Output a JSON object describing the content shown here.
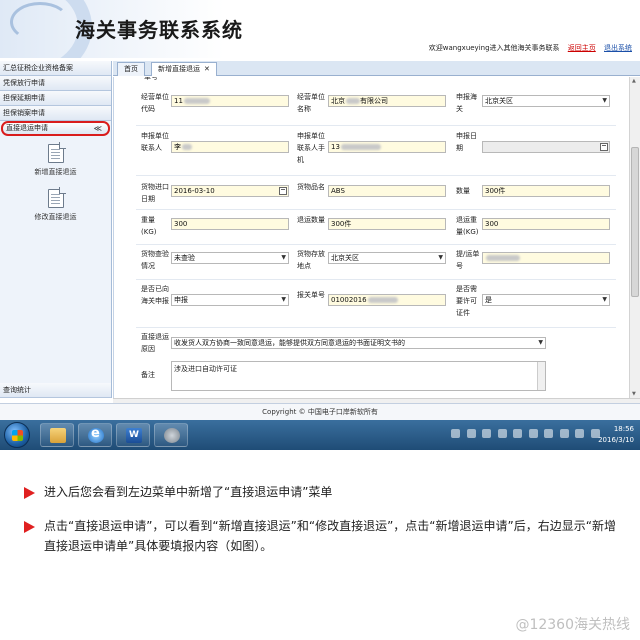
{
  "header": {
    "title": "海关事务联系系统",
    "welcome_text": "欢迎wangxueying进入其他海关事务联系",
    "return_home": "返回主页",
    "logout": "退出系统"
  },
  "sidebar": {
    "items": [
      {
        "label": "汇总征税企业资格备案"
      },
      {
        "label": "凭保放行申请"
      },
      {
        "label": "担保延期申请"
      },
      {
        "label": "担保销案申请"
      }
    ],
    "active_item": {
      "label": "直接退运申请",
      "collapse_glyph": "≪"
    },
    "sub_items": [
      {
        "label": "新增直接退运"
      },
      {
        "label": "修改直接退运"
      }
    ],
    "bottom_item": {
      "label": "查询统计"
    }
  },
  "tabs": {
    "home": "首页",
    "new": "新增直接退运",
    "close_glyph": "✕"
  },
  "form": {
    "top_cut_label": "单号",
    "row1": {
      "l1": "经营单位代码",
      "v1": "11",
      "l2": "经营单位名称",
      "v2a": "北京",
      "v2b": "有限公司",
      "l3": "申报海关",
      "v3": "北京关区"
    },
    "row2": {
      "l1": "申报单位联系人",
      "v1": "李",
      "l2": "申报单位联系人手机",
      "v2": "13",
      "l3": "申报日期",
      "v3": ""
    },
    "row3": {
      "l1": "货物进口日期",
      "v1": "2016-03-10",
      "l2": "货物品名",
      "v2": "ABS",
      "l3": "数量",
      "v3": "300件"
    },
    "row4": {
      "l1": "重量(KG)",
      "v1": "300",
      "l2": "退运数量",
      "v2": "300件",
      "l3": "退运重量(KG)",
      "v3": "300"
    },
    "row5": {
      "l1": "货物查验情况",
      "v1": "未查验",
      "l2": "货物存放地点",
      "v2": "北京关区",
      "l3": "提/运单号",
      "v3": ""
    },
    "row6": {
      "l1": "是否已向海关申报",
      "v1": "申报",
      "l2": "报关单号",
      "v2": "01002016",
      "l3": "是否需要许可证件",
      "v3": "是"
    },
    "reason": {
      "label": "直接退运原因",
      "value": "收发货人双方协商一致同意退运，能够提供双方同意退运的书面证明文书的"
    },
    "remark": {
      "label": "备注",
      "value": "涉及进口自动许可证"
    }
  },
  "footer": {
    "copyright": "Copyright © 中国电子口岸新软所有"
  },
  "taskbar": {
    "time": "18:56",
    "date": "2016/3/10"
  },
  "notes": [
    "进入后您会看到左边菜单中新增了“直接退运申请”菜单",
    "点击“直接退运申请”，可以看到“新增直接退运”和“修改直接退运”，点击“新增退运申请”后，右边显示“新增直接退运申请单”具体要填报内容（如图）。"
  ],
  "watermark": "@12360海关热线",
  "colors": {
    "accent_red": "#e02020",
    "field_yellow": "#fffbe0",
    "sidebar_blue": "#eef3fa"
  }
}
